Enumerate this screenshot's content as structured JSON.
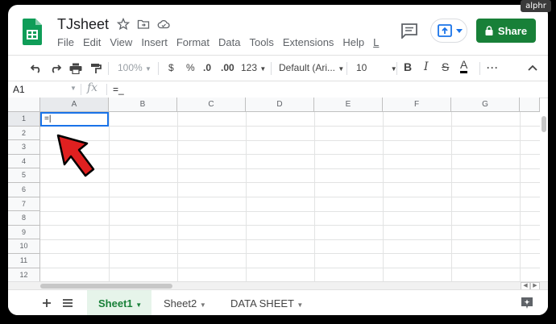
{
  "watermark": "alphr",
  "app": {
    "title": "TJsheet",
    "menu": [
      "File",
      "Edit",
      "View",
      "Insert",
      "Format",
      "Data",
      "Tools",
      "Extensions",
      "Help",
      "L"
    ],
    "share_label": "Share"
  },
  "toolbar": {
    "zoom": "100%",
    "currency": "$",
    "percent": "%",
    "dec_decrease": ".0",
    "dec_increase": ".00",
    "more_formats": "123",
    "font": "Default (Ari...",
    "font_size": "10",
    "bold": "B",
    "italic": "I",
    "strike": "S",
    "text_color": "A",
    "more": "···"
  },
  "formula_bar": {
    "cell_ref": "A1",
    "fx": "fx",
    "value": "=_"
  },
  "grid": {
    "columns": [
      "A",
      "B",
      "C",
      "D",
      "E",
      "F",
      "G"
    ],
    "rows": [
      "1",
      "2",
      "3",
      "4",
      "5",
      "6",
      "7",
      "8",
      "9",
      "10",
      "11",
      "12"
    ],
    "active_cell_value": "=|"
  },
  "sheets": {
    "tabs": [
      "Sheet1",
      "Sheet2",
      "DATA SHEET"
    ],
    "active": "Sheet1"
  },
  "colors": {
    "brand_green": "#188038",
    "selection_blue": "#1a73e8",
    "arrow_red": "#e02020"
  }
}
